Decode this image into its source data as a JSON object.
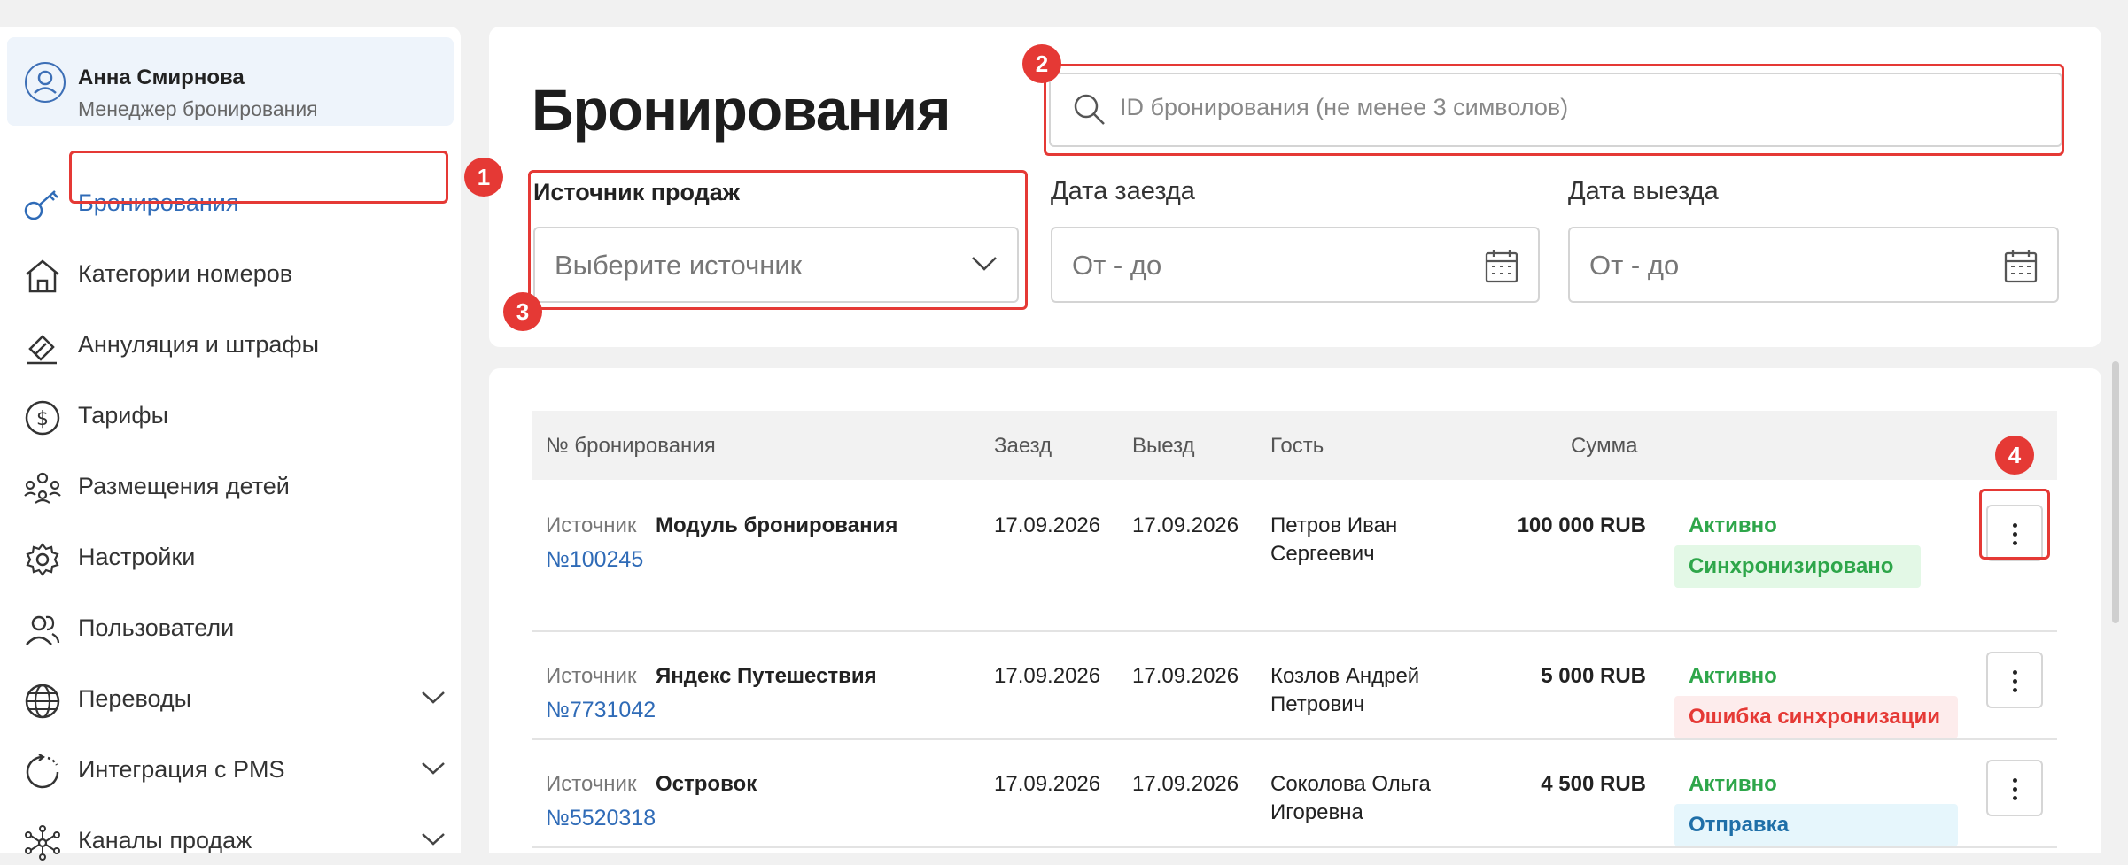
{
  "user": {
    "name": "Анна Смирнова",
    "role": "Менеджер бронирования"
  },
  "sidebar": {
    "items": [
      {
        "label": "Бронирования",
        "icon": "key-icon",
        "active": true
      },
      {
        "label": "Категории номеров",
        "icon": "home-icon"
      },
      {
        "label": "Аннуляция и штрафы",
        "icon": "eraser-icon"
      },
      {
        "label": "Тарифы",
        "icon": "dollar-icon"
      },
      {
        "label": "Размещения детей",
        "icon": "people-icon"
      },
      {
        "label": "Настройки",
        "icon": "gear-icon"
      },
      {
        "label": "Пользователи",
        "icon": "users-icon"
      },
      {
        "label": "Переводы",
        "icon": "globe-icon",
        "expandable": true
      },
      {
        "label": "Интеграция с PMS",
        "icon": "refresh-icon",
        "expandable": true
      },
      {
        "label": "Каналы продаж",
        "icon": "network-icon",
        "expandable": true
      }
    ]
  },
  "header": {
    "title": "Бронирования"
  },
  "search": {
    "placeholder": "ID бронирования (не менее 3 символов)"
  },
  "filters": {
    "source": {
      "label": "Источник продаж",
      "placeholder": "Выберите источник"
    },
    "checkin": {
      "label": "Дата заезда",
      "placeholder": "От - до"
    },
    "checkout": {
      "label": "Дата выезда",
      "placeholder": "От - до"
    }
  },
  "table": {
    "headers": {
      "number": "№ бронирования",
      "checkin": "Заезд",
      "checkout": "Выезд",
      "guest": "Гость",
      "amount": "Сумма"
    },
    "source_label": "Источник",
    "rows": [
      {
        "source": "Модуль бронирования",
        "number": "№100245",
        "checkin": "17.09.2026",
        "checkout": "17.09.2026",
        "guest_line1": "Петров Иван",
        "guest_line2": "Сергеевич",
        "amount": "100 000 RUB",
        "status": "Активно",
        "sync": "Синхронизировано"
      },
      {
        "source": "Яндекс Путешествия",
        "number": "№7731042",
        "checkin": "17.09.2026",
        "checkout": "17.09.2026",
        "guest_line1": "Козлов Андрей",
        "guest_line2": "Петрович",
        "amount": "5 000 RUB",
        "status": "Активно",
        "sync": "Ошибка синхронизации"
      },
      {
        "source": "Островок",
        "number": "№5520318",
        "checkin": "17.09.2026",
        "checkout": "17.09.2026",
        "guest_line1": "Соколова Ольга",
        "guest_line2": "Игоревна",
        "amount": "4 500 RUB",
        "status": "Активно",
        "sync": "Отправка"
      }
    ]
  },
  "markers": [
    "1",
    "2",
    "3",
    "4"
  ],
  "colors": {
    "accent": "#2f6bb7",
    "marker": "#e53935",
    "active": "#2ea64a",
    "ok_bg": "#e3f8e6",
    "err_text": "#e53935",
    "err_bg": "#fdecec",
    "send_text": "#1f6fa8",
    "send_bg": "#e6f6fc"
  }
}
